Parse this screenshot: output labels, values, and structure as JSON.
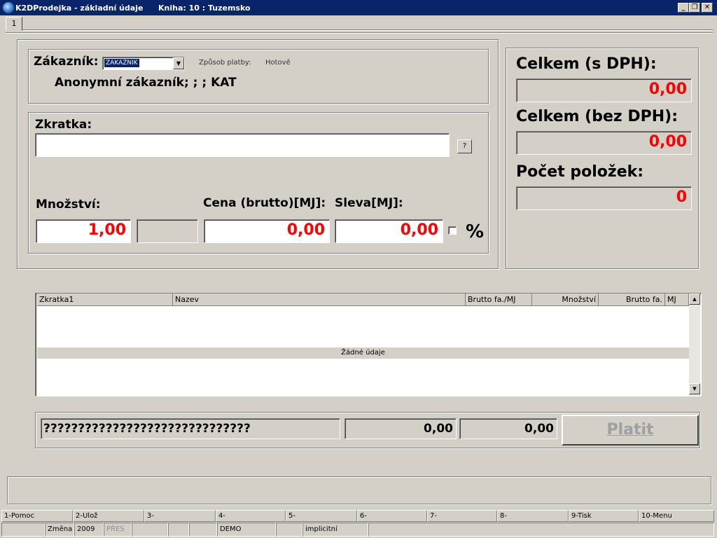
{
  "window": {
    "title": "K2DProdejka - základní údaje",
    "book": "Kniha: 10 : Tuzemsko",
    "minimize": "_",
    "restore": "❐",
    "close": "✕"
  },
  "tab": {
    "label": "1"
  },
  "customer": {
    "label": "Zákazník:",
    "select_value": "ZAKAZNIK",
    "payment_label": "Způsob platby:",
    "payment_value": "Hotově",
    "description": "Anonymní zákazník; ; ; KAT"
  },
  "entry": {
    "shortcut_label": "Zkratka:",
    "shortcut_value": "",
    "help_button": "?",
    "quantity_label": "Množství:",
    "quantity_value": "1,00",
    "unit_value": "",
    "price_label": "Cena (brutto)[MJ]:",
    "price_value": "0,00",
    "discount_label": "Sleva[MJ]:",
    "discount_value": "0,00",
    "percent_label": "%"
  },
  "totals": {
    "with_vat_label": "Celkem (s DPH):",
    "with_vat_value": "0,00",
    "without_vat_label": "Celkem (bez DPH):",
    "without_vat_value": "0,00",
    "count_label": "Počet položek:",
    "count_value": "0"
  },
  "table": {
    "columns": [
      "Zkratka1",
      "Nazev",
      "Brutto fa./MJ",
      "Množství",
      "Brutto fa.",
      "MJ"
    ],
    "empty_text": "Žádné údaje"
  },
  "summary": {
    "text": "??????????????????????????????",
    "value1": "0,00",
    "value2": "0,00",
    "pay_button": "Platit"
  },
  "fkeys": [
    "1-Pomoc",
    "2-Ulož",
    "3-",
    "4-",
    "5-",
    "6-",
    "7-",
    "8-",
    "9-Tisk",
    "10-Menu"
  ],
  "status": {
    "mode": "Změna",
    "year": "2009",
    "overwrite": "PŘES",
    "demo": "DEMO",
    "profile": "implicitní"
  },
  "colors": {
    "titlebar": "#0a246a",
    "value_red": "#ff0000",
    "window_bg": "#d4d0c8"
  }
}
